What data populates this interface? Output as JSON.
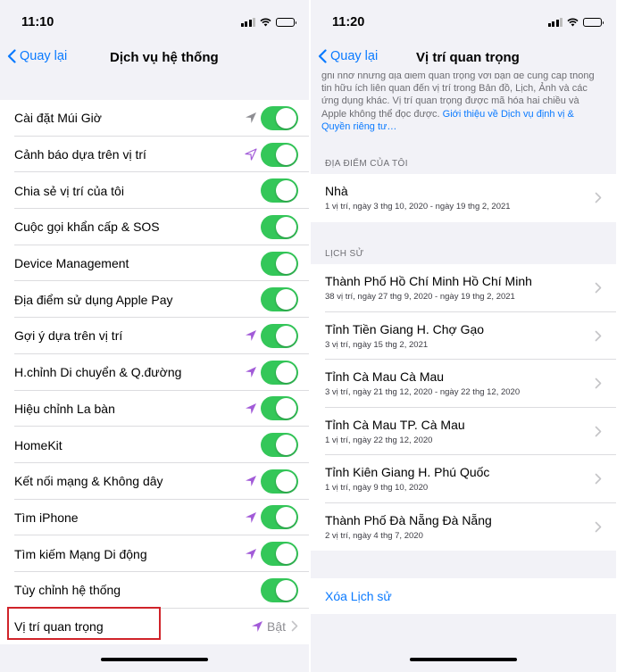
{
  "colors": {
    "accent": "#0a7aff",
    "toggle_on": "#34c759",
    "location_purple": "#a25bd8",
    "location_gray": "#8e8e93",
    "highlight": "#d0232a"
  },
  "left": {
    "status_time": "11:10",
    "back_label": "Quay lại",
    "title": "Dịch vụ hệ thống",
    "rows": [
      {
        "label": "Cài đặt Múi Giờ",
        "arrow": "gray-filled",
        "toggle": true
      },
      {
        "label": "Cảnh báo dựa trên vị trí",
        "arrow": "purple-outline",
        "toggle": true
      },
      {
        "label": "Chia sẻ vị trí của tôi",
        "arrow": "none",
        "toggle": true
      },
      {
        "label": "Cuộc gọi khẩn cấp & SOS",
        "arrow": "none",
        "toggle": true
      },
      {
        "label": "Device Management",
        "arrow": "none",
        "toggle": true
      },
      {
        "label": "Địa điểm sử dụng Apple Pay",
        "arrow": "none",
        "toggle": true
      },
      {
        "label": "Gợi ý dựa trên vị trí",
        "arrow": "purple-filled",
        "toggle": true
      },
      {
        "label": "H.chỉnh Di chuyển & Q.đường",
        "arrow": "purple-filled",
        "toggle": true
      },
      {
        "label": "Hiệu chỉnh La bàn",
        "arrow": "purple-filled",
        "toggle": true
      },
      {
        "label": "HomeKit",
        "arrow": "none",
        "toggle": true
      },
      {
        "label": "Kết nối mạng & Không dây",
        "arrow": "purple-filled",
        "toggle": true
      },
      {
        "label": "Tìm iPhone",
        "arrow": "purple-filled",
        "toggle": true
      },
      {
        "label": "Tìm kiếm Mạng Di động",
        "arrow": "purple-filled",
        "toggle": true
      },
      {
        "label": "Tùy chỉnh hệ thống",
        "arrow": "none",
        "toggle": true
      },
      {
        "label": "Vị trí quan trọng",
        "arrow": "purple-filled",
        "value": "Bật"
      }
    ]
  },
  "right": {
    "status_time": "11:20",
    "back_label": "Quay lại",
    "title": "Vị trí quan trọng",
    "intro_lines": [
      "ghi nhớ những địa điểm quan trọng với bạn để cung cấp thông",
      "tin hữu ích liên quan đến vị trí trong Bản đồ, Lịch, Ảnh và các",
      "ứng dụng khác. Vị trí quan trọng được mã hóa hai chiều và"
    ],
    "intro_line4_text": "Apple không thể đọc được. ",
    "intro_link_a": "Giới thiệu về Dịch vụ định vị &",
    "intro_link_b": "Quyền riêng tư…",
    "my_places_header": "ĐỊA ĐIỂM CỦA TÔI",
    "my_places": [
      {
        "title": "Nhà",
        "subtitle": "1 vị trí, ngày 3 thg 10, 2020 - ngày 19 thg 2, 2021"
      }
    ],
    "history_header": "LỊCH SỬ",
    "history": [
      {
        "title": "Thành Phố Hồ Chí Minh Hồ Chí Minh",
        "subtitle": "38 vị trí, ngày 27 thg 9, 2020 - ngày 19 thg 2, 2021"
      },
      {
        "title": "Tỉnh Tiền Giang H. Chợ Gạo",
        "subtitle": "3 vị trí, ngày 15 thg 2, 2021"
      },
      {
        "title": "Tỉnh Cà Mau Cà Mau",
        "subtitle": "3 vị trí, ngày 21 thg 12, 2020 - ngày 22 thg 12, 2020"
      },
      {
        "title": "Tỉnh Cà Mau TP. Cà Mau",
        "subtitle": "1 vị trí, ngày 22 thg 12, 2020"
      },
      {
        "title": "Tỉnh Kiên Giang H. Phú Quốc",
        "subtitle": "1 vị trí, ngày 9 thg 10, 2020"
      },
      {
        "title": "Thành Phố Đà Nẵng Đà Nẵng",
        "subtitle": "2 vị trí, ngày 4 thg 7, 2020"
      }
    ],
    "clear_history": "Xóa Lịch sử"
  }
}
